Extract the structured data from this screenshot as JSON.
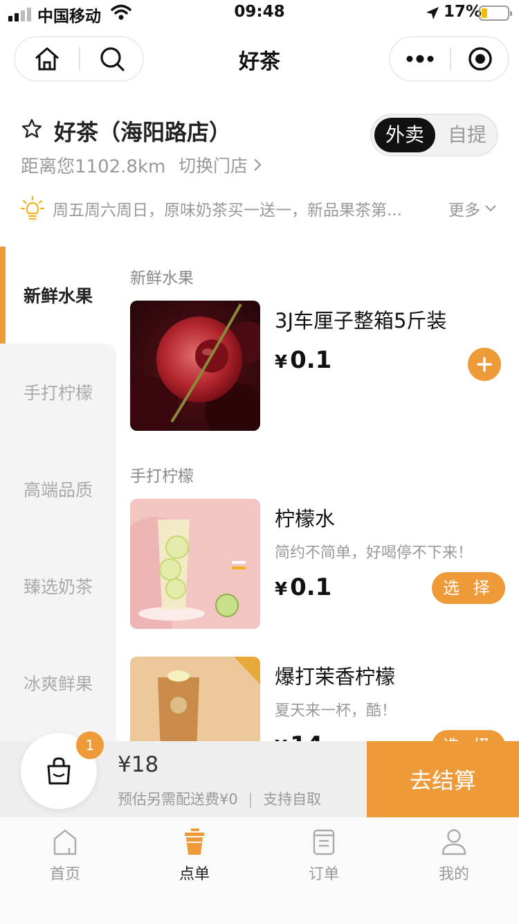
{
  "status_bar": {
    "carrier": "中国移动",
    "time": "09:48",
    "battery_percent": "17%"
  },
  "header": {
    "title": "好茶"
  },
  "store": {
    "name": "好茶（海阳路店）",
    "distance": "距离您1102.8km",
    "switch_label": "切换门店",
    "modes": [
      "外卖",
      "自提"
    ],
    "active_mode": "外卖"
  },
  "promo": {
    "text": "周五周六周日，原味奶茶买一送一，新品果茶第...",
    "more_label": "更多"
  },
  "categories": [
    {
      "label": "新鲜水果",
      "active": true
    },
    {
      "label": "手打柠檬",
      "active": false
    },
    {
      "label": "高端品质",
      "active": false
    },
    {
      "label": "臻选奶茶",
      "active": false
    },
    {
      "label": "冰爽鲜果",
      "active": false
    }
  ],
  "sections": [
    {
      "title": "新鲜水果",
      "products": [
        {
          "name": "3J车厘子整箱5斤装",
          "currency": "¥",
          "price": "0.1",
          "action": "add"
        }
      ]
    },
    {
      "title": "手打柠檬",
      "products": [
        {
          "name": "柠檬水",
          "description": "简约不简单，好喝停不下来！",
          "currency": "¥",
          "price": "0.1",
          "action_label": "选 择"
        },
        {
          "name": "爆打茉香柠檬",
          "description": "夏天来一杯，酷！",
          "currency": "¥",
          "price": "14",
          "action_label": "选 择"
        }
      ]
    }
  ],
  "cart": {
    "count": "1",
    "total": "¥18",
    "delivery_note": "预估另需配送费¥0",
    "pickup_note": "支持自取",
    "checkout_label": "去结算"
  },
  "tabs": [
    {
      "label": "首页",
      "icon": "home-icon",
      "active": false
    },
    {
      "label": "点单",
      "icon": "cup-icon",
      "active": true
    },
    {
      "label": "订单",
      "icon": "order-icon",
      "active": false
    },
    {
      "label": "我的",
      "icon": "user-icon",
      "active": false
    }
  ],
  "colors": {
    "accent": "#ef9a39",
    "active_toggle": "#111111",
    "muted_text": "#999999"
  }
}
